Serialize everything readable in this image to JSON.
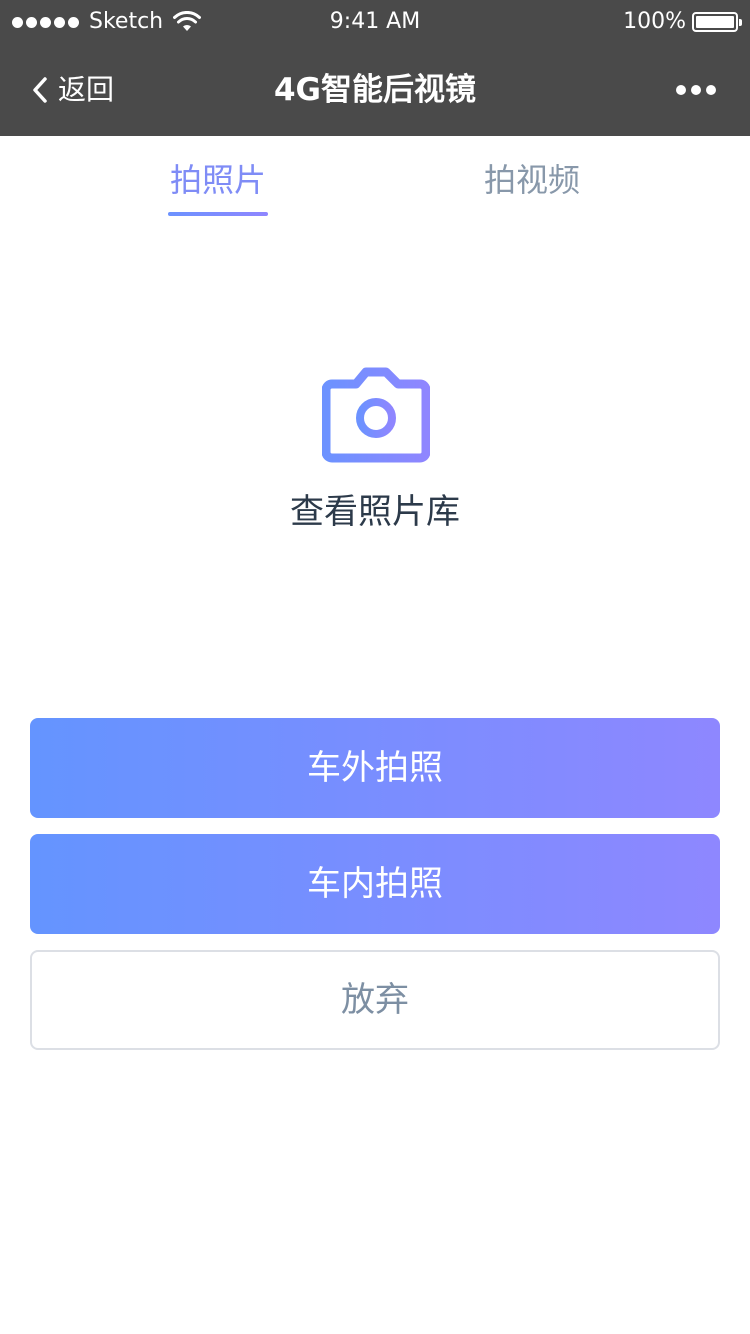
{
  "status_bar": {
    "carrier": "Sketch",
    "time": "9:41 AM",
    "battery": "100%",
    "signal_icon": "signal-dots-icon",
    "wifi_icon": "wifi-icon",
    "battery_icon": "battery-icon"
  },
  "nav": {
    "back_label": "返回",
    "back_icon": "chevron-left-icon",
    "title": "4G智能后视镜",
    "more_icon": "more-horizontal-icon"
  },
  "tabs": [
    {
      "label": "拍照片",
      "active": true
    },
    {
      "label": "拍视频",
      "active": false
    }
  ],
  "gallery": {
    "icon": "camera-icon",
    "label": "查看照片库"
  },
  "buttons": {
    "outside_photo": "车外拍照",
    "inside_photo": "车内拍照",
    "cancel": "放弃"
  },
  "colors": {
    "header_bg": "#4a4a4a",
    "accent": "#7f8cf6",
    "gradient_start": "#6494ff",
    "gradient_end": "#8e87ff",
    "inactive_tab": "#8898aa"
  }
}
